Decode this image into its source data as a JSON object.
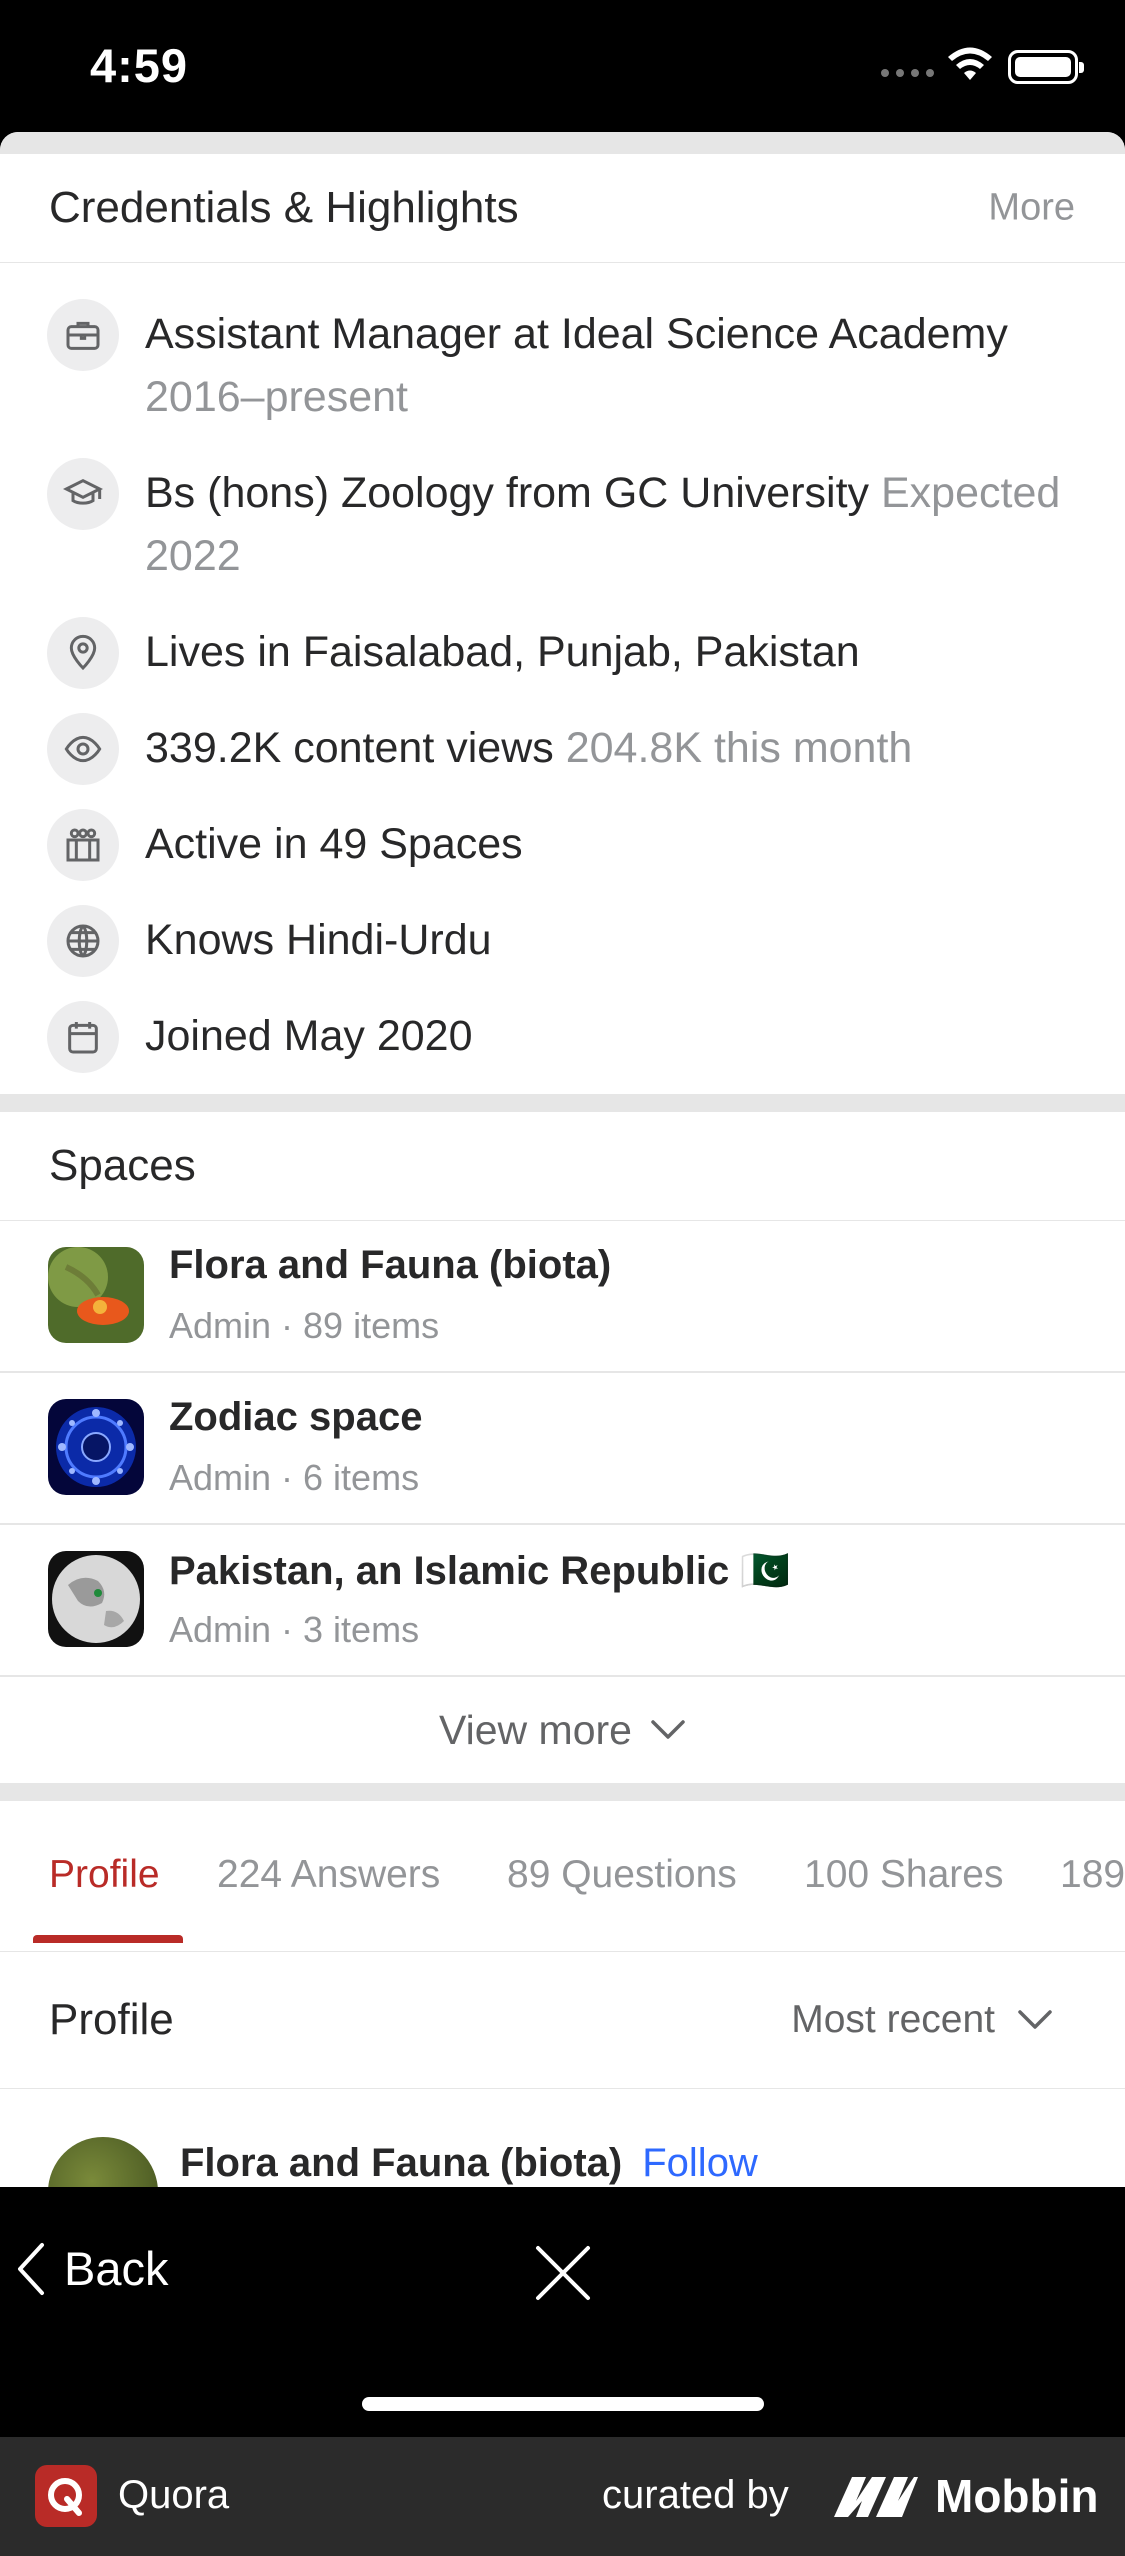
{
  "status_bar": {
    "time": "4:59"
  },
  "credentials": {
    "title": "Credentials & Highlights",
    "more_label": "More",
    "items": [
      {
        "icon": "briefcase-icon",
        "text": "Assistant Manager at Ideal Science Academy",
        "muted": "2016–present"
      },
      {
        "icon": "graduation-cap-icon",
        "text": "Bs (hons) Zoology from GC University",
        "muted": "Expected 2022"
      },
      {
        "icon": "location-pin-icon",
        "text": "Lives in Faisalabad, Punjab, Pakistan",
        "muted": ""
      },
      {
        "icon": "eye-icon",
        "text": "339.2K content views",
        "muted": "204.8K this month"
      },
      {
        "icon": "spaces-icon",
        "text": "Active in 49 Spaces",
        "muted": ""
      },
      {
        "icon": "globe-icon",
        "text": "Knows Hindi-Urdu",
        "muted": ""
      },
      {
        "icon": "calendar-icon",
        "text": "Joined May 2020",
        "muted": ""
      }
    ]
  },
  "spaces": {
    "title": "Spaces",
    "items": [
      {
        "name": "Flora and Fauna (biota)",
        "meta": "Admin · 89 items"
      },
      {
        "name": "Zodiac space",
        "meta": "Admin · 6 items"
      },
      {
        "name": "Pakistan, an Islamic Republic 🇵🇰",
        "meta": "Admin · 3 items"
      }
    ],
    "view_more": "View more"
  },
  "tabs": {
    "items": [
      "Profile",
      "224 Answers",
      "89 Questions",
      "100 Shares",
      "189"
    ],
    "active": "Profile"
  },
  "profile_section": {
    "title": "Profile",
    "sort_label": "Most recent"
  },
  "feed_peek": {
    "name": "Flora and Fauna (biota)",
    "follow": "Follow"
  },
  "nav": {
    "back_label": "Back"
  },
  "footer": {
    "app_name": "Quora",
    "curated_by": "curated by",
    "brand": "Mobbin"
  },
  "colors": {
    "accent": "#b92b27",
    "text": "#282829",
    "muted": "#939598",
    "link": "#2e69ff"
  }
}
